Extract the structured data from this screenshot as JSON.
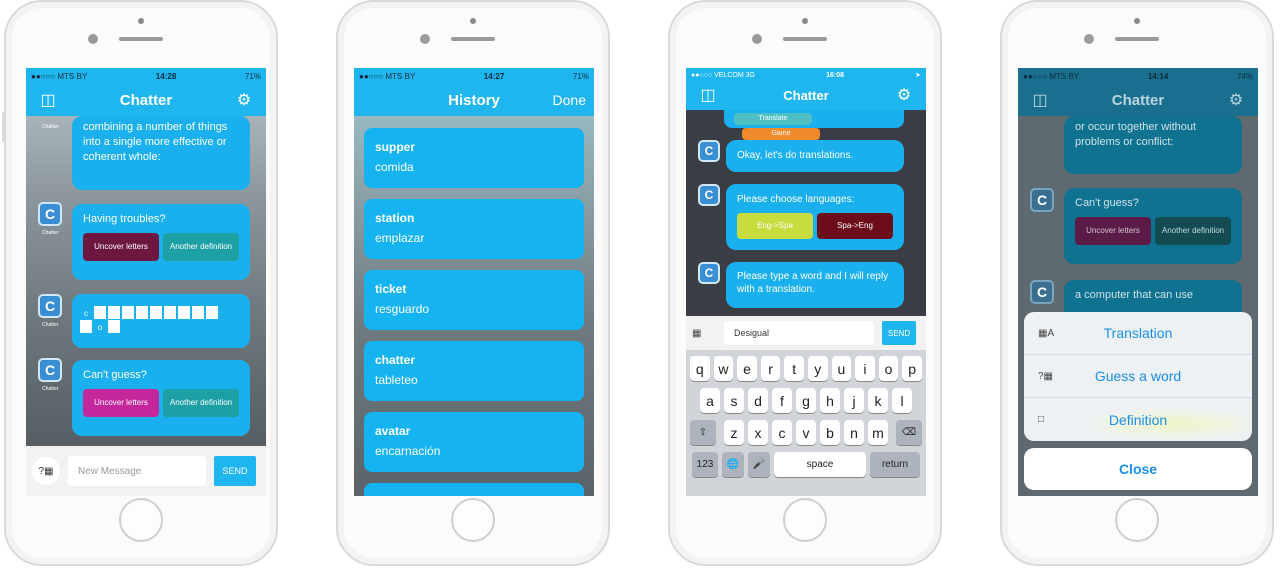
{
  "colors": {
    "accent": "#1fb6f0",
    "bubble": "#1ab0ee",
    "maroon": "#6d1740",
    "teal": "#1d9fa6",
    "magenta": "#c4279c"
  },
  "screen1": {
    "status": {
      "carrier": "●●○○○ MTS BY",
      "time": "14:28",
      "battery": "71%"
    },
    "nav": {
      "title": "Chatter",
      "left_icon": "book-icon",
      "right_icon": "gear-icon"
    },
    "avatar_letter": "C",
    "avatar_label": "Chatter",
    "msg1": "combining a number of things into a single more effective or coherent whole:",
    "msg2": "Having troubles?",
    "btn_uncover": "Uncover letters",
    "btn_another": "Another definition",
    "puzzle_c": "c",
    "puzzle_o": "o",
    "msg4": "Can't guess?",
    "input_placeholder": "New Message",
    "send": "SEND"
  },
  "screen2": {
    "status": {
      "carrier": "●●○○○ MTS BY",
      "time": "14:27",
      "battery": "71%"
    },
    "nav": {
      "title": "History",
      "done": "Done"
    },
    "items": [
      {
        "word": "supper",
        "translation": "comida"
      },
      {
        "word": "station",
        "translation": "emplazar"
      },
      {
        "word": "ticket",
        "translation": "resguardo"
      },
      {
        "word": "chatter",
        "translation": "tableteo"
      },
      {
        "word": "avatar",
        "translation": "encarnación"
      }
    ]
  },
  "screen3": {
    "status": {
      "carrier": "●●○○○ VELCOM  3G",
      "time": "16:08"
    },
    "nav": {
      "title": "Chatter"
    },
    "top_btn1": "Translate",
    "top_btn2": "Game",
    "msg1": "Okay, let's do translations.",
    "msg2": "Please choose languages:",
    "btn_eng_spa": "Eng->Spa",
    "btn_spa_eng": "Spa->Eng",
    "msg3": "Please type a word and I will reply with a translation.",
    "input_value": "Desigual",
    "send": "SEND",
    "kb_row1": [
      "q",
      "w",
      "e",
      "r",
      "t",
      "y",
      "u",
      "i",
      "o",
      "p"
    ],
    "kb_row2": [
      "a",
      "s",
      "d",
      "f",
      "g",
      "h",
      "j",
      "k",
      "l"
    ],
    "kb_row3": [
      "z",
      "x",
      "c",
      "v",
      "b",
      "n",
      "m"
    ],
    "kb_123": "123",
    "kb_space": "space",
    "kb_return": "return"
  },
  "screen4": {
    "status": {
      "carrier": "●●○○○ MTS BY",
      "time": "14:14",
      "battery": "74%"
    },
    "nav": {
      "title": "Chatter"
    },
    "msg1": "or occur together without problems or conflict:",
    "msg2": "Can't guess?",
    "btn_uncover": "Uncover letters",
    "btn_another": "Another definition",
    "msg3": "a computer that can use",
    "menu": [
      "Translation",
      "Guess a word",
      "Definition"
    ],
    "close": "Close"
  }
}
